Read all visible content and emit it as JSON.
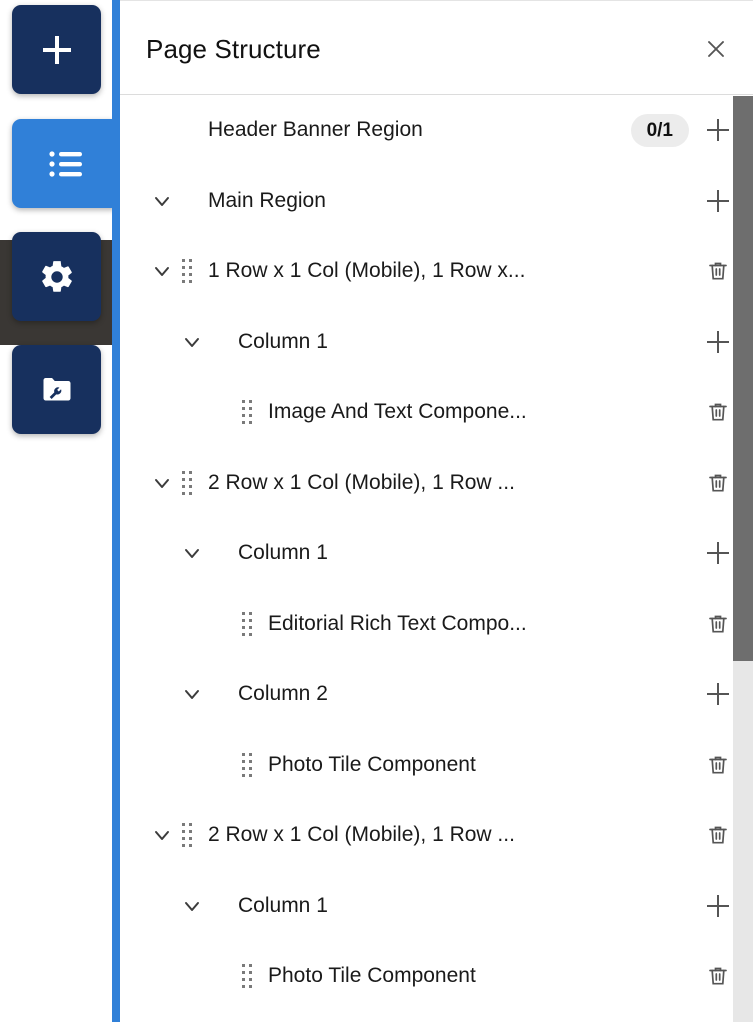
{
  "colors": {
    "rail_button": "#17305e",
    "rail_button_active": "#3080d8",
    "rail_divider": "#3080d8",
    "rail_band": "#3a3734",
    "badge_bg": "#ececec",
    "scrollbar_thumb": "#6e6e6e",
    "scrollbar_track": "#e7e7e7"
  },
  "rail": {
    "buttons": [
      {
        "name": "add-button",
        "icon": "plus-icon",
        "active": false
      },
      {
        "name": "structure-button",
        "icon": "list-icon",
        "active": true
      },
      {
        "name": "settings-button",
        "icon": "gear-icon",
        "active": false
      },
      {
        "name": "assets-button",
        "icon": "folder-wrench-icon",
        "active": false
      }
    ]
  },
  "panel": {
    "title": "Page Structure",
    "close_icon": "close-icon"
  },
  "tree": {
    "rows": [
      {
        "label": "Header Banner Region",
        "indent": 1,
        "chevron": false,
        "drag": false,
        "badge": "0/1",
        "action": "add"
      },
      {
        "label": "Main Region",
        "indent": 0,
        "chevron": true,
        "drag": false,
        "badge": null,
        "action": "add"
      },
      {
        "label": "1 Row x 1 Col (Mobile), 1 Row x...",
        "indent": 1,
        "chevron": true,
        "drag": true,
        "badge": null,
        "action": "delete"
      },
      {
        "label": "Column 1",
        "indent": 2,
        "chevron": true,
        "drag": false,
        "badge": null,
        "action": "add"
      },
      {
        "label": "Image And Text Compone...",
        "indent": 3,
        "chevron": false,
        "drag": true,
        "badge": null,
        "action": "delete"
      },
      {
        "label": "2 Row x 1 Col (Mobile), 1 Row ...",
        "indent": 1,
        "chevron": true,
        "drag": true,
        "badge": null,
        "action": "delete"
      },
      {
        "label": "Column 1",
        "indent": 2,
        "chevron": true,
        "drag": false,
        "badge": null,
        "action": "add"
      },
      {
        "label": "Editorial Rich Text Compo...",
        "indent": 3,
        "chevron": false,
        "drag": true,
        "badge": null,
        "action": "delete"
      },
      {
        "label": "Column 2",
        "indent": 2,
        "chevron": true,
        "drag": false,
        "badge": null,
        "action": "add"
      },
      {
        "label": "Photo Tile Component",
        "indent": 3,
        "chevron": false,
        "drag": true,
        "badge": null,
        "action": "delete"
      },
      {
        "label": "2 Row x 1 Col (Mobile), 1 Row ...",
        "indent": 1,
        "chevron": true,
        "drag": true,
        "badge": null,
        "action": "delete"
      },
      {
        "label": "Column 1",
        "indent": 2,
        "chevron": true,
        "drag": false,
        "badge": null,
        "action": "add"
      },
      {
        "label": "Photo Tile Component",
        "indent": 3,
        "chevron": false,
        "drag": true,
        "badge": null,
        "action": "delete"
      }
    ]
  },
  "scrollbar": {
    "name": "panel-scrollbar"
  }
}
